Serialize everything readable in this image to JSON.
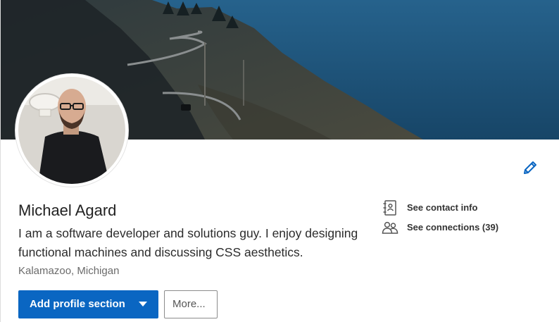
{
  "profile": {
    "name": "Michael Agard",
    "headline": "I am a software developer and solutions guy. I enjoy designing functional machines and discussing CSS aesthetics.",
    "location": "Kalamazoo, Michigan"
  },
  "actions": {
    "primary_label": "Add profile section",
    "secondary_label": "More..."
  },
  "sidebar_links": {
    "contact": "See contact info",
    "connections": "See connections (39)"
  },
  "icons": {
    "edit": "pencil-icon",
    "contact": "address-book-icon",
    "connections": "people-icon",
    "dropdown": "caret-down-icon"
  },
  "colors": {
    "accent": "#0a66c2",
    "banner_ocean": "#1f4f74"
  }
}
